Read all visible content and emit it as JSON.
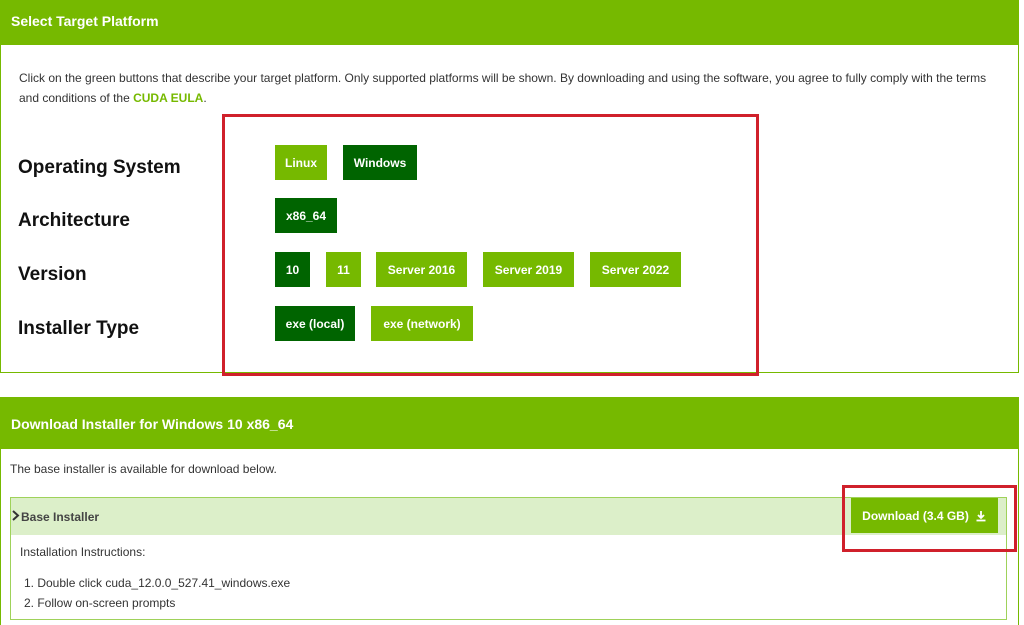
{
  "select_panel": {
    "title": "Select Target Platform",
    "intro_text": "Click on the green buttons that describe your target platform. Only supported platforms will be shown. By downloading and using the software, you agree to fully comply with the terms and conditions of the ",
    "eula_link": "CUDA EULA",
    "intro_end": ".",
    "rows": {
      "os": {
        "label": "Operating System",
        "options": [
          "Linux",
          "Windows"
        ],
        "selected": "Windows"
      },
      "arch": {
        "label": "Architecture",
        "options": [
          "x86_64"
        ],
        "selected": "x86_64"
      },
      "version": {
        "label": "Version",
        "options": [
          "10",
          "11",
          "Server 2016",
          "Server 2019",
          "Server 2022"
        ],
        "selected": "10"
      },
      "installer": {
        "label": "Installer Type",
        "options": [
          "exe (local)",
          "exe (network)"
        ],
        "selected": "exe (local)"
      }
    }
  },
  "download_panel": {
    "title": "Download Installer for Windows 10 x86_64",
    "description": "The base installer is available for download below.",
    "base_installer_label": "Base Installer",
    "download_label": "Download (3.4 GB)",
    "instructions_title": "Installation Instructions:",
    "steps": [
      "1. Double click cuda_12.0.0_527.41_windows.exe",
      "2. Follow on-screen prompts"
    ]
  },
  "colors": {
    "brand_green": "#76b900",
    "selected_green": "#006400",
    "highlight_red": "#d0202b"
  }
}
